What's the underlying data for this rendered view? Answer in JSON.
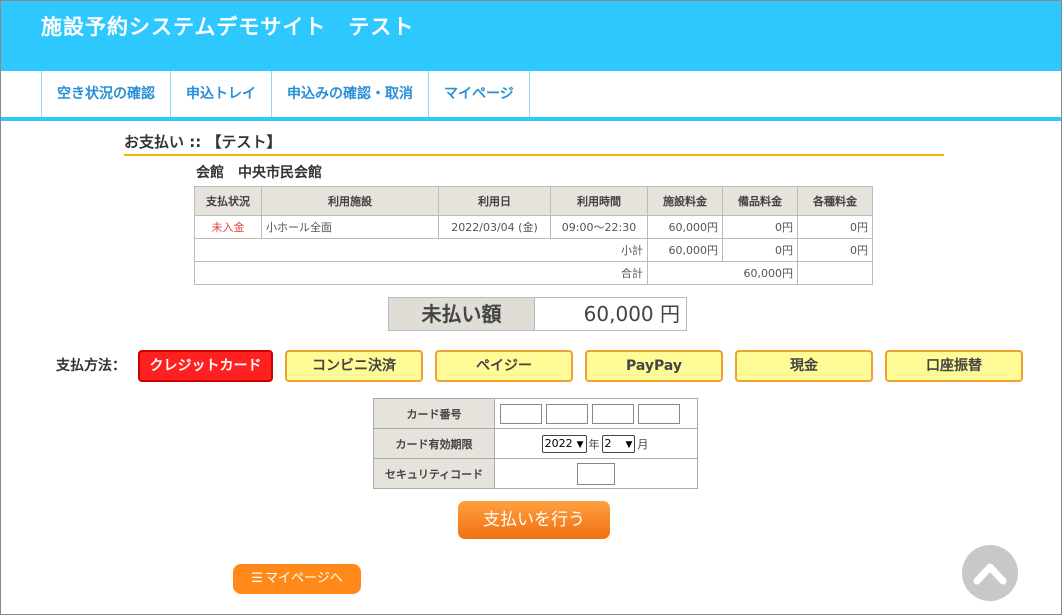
{
  "app": {
    "title": "施設予約システムデモサイト　テスト"
  },
  "nav": {
    "tabs": [
      {
        "label": "空き状況の確認"
      },
      {
        "label": "申込トレイ"
      },
      {
        "label": "申込みの確認・取消"
      },
      {
        "label": "マイページ"
      }
    ]
  },
  "page": {
    "title": "お支払い :: 【テスト】",
    "venue": "会館　中央市民会館"
  },
  "reservation": {
    "headers": [
      "支払状況",
      "利用施設",
      "利用日",
      "利用時間",
      "施設料金",
      "備品料金",
      "各種料金"
    ],
    "row": {
      "status": "未入金",
      "facility": "小ホール全面",
      "date": "2022/03/04 (金)",
      "time": "09:00～22:30",
      "facility_fee": "60,000円",
      "equipment_fee": "0円",
      "other_fee": "0円"
    },
    "subtotal": {
      "label": "小計",
      "facility_fee": "60,000円",
      "equipment_fee": "0円",
      "other_fee": "0円"
    },
    "total": {
      "label": "合計",
      "value": "60,000円"
    }
  },
  "unpaid": {
    "label": "未払い額",
    "value": "60,000 円"
  },
  "payment": {
    "label": "支払方法：",
    "methods": [
      {
        "label": "クレジットカード",
        "selected": true
      },
      {
        "label": "コンビニ決済",
        "selected": false
      },
      {
        "label": "ペイジー",
        "selected": false
      },
      {
        "label": "PayPay",
        "selected": false
      },
      {
        "label": "現金",
        "selected": false
      },
      {
        "label": "口座振替",
        "selected": false
      }
    ]
  },
  "card_form": {
    "number_label": "カード番号",
    "expiry_label": "カード有効期限",
    "year_value": "2022",
    "year_unit": "年",
    "month_value": "2",
    "month_unit": "月",
    "security_label": "セキュリティコード"
  },
  "buttons": {
    "pay": "支払いを行う",
    "mypage": "マイページへ",
    "mypage_icon": "☰"
  },
  "icons": {
    "hamburger": "menu-icon",
    "back_to_top": "chevron-up-icon"
  },
  "colors": {
    "header": "#2ec8ff",
    "accent": "#ff8a1a",
    "selected_method": "#ff2020",
    "method_bg": "#fffb96"
  }
}
